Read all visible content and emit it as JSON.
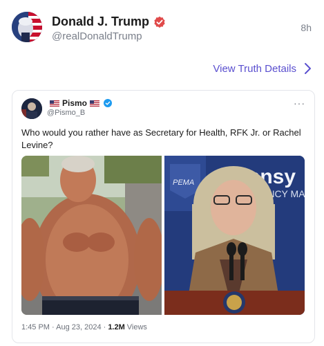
{
  "post": {
    "display_name": "Donald J. Trump",
    "handle": "@realDonaldTrump",
    "time": "8h",
    "view_details": "View Truth Details"
  },
  "embedded": {
    "author_name": "Pismo",
    "author_handle": "@Pismo_B",
    "more": "···",
    "text": "Who would you rather have as Secretary for Health, RFK Jr. or Rachel Levine?",
    "timestamp": "1:45 PM · Aug 23, 2024 ·",
    "views_count": "1.2M",
    "views_label": "Views",
    "right_photo_sign_text": "nnsy",
    "right_photo_sign_sub": "ENCY MA",
    "right_photo_pema": "PEMA"
  },
  "colors": {
    "accent": "#5a4fcf",
    "verified_red": "#e04a4a",
    "verified_blue": "#1d9bf0"
  },
  "icons": {
    "verified_red": "verified-badge-icon",
    "chevron": "chevron-right-icon",
    "verified_blue": "verified-badge-icon",
    "more": "more-icon"
  }
}
